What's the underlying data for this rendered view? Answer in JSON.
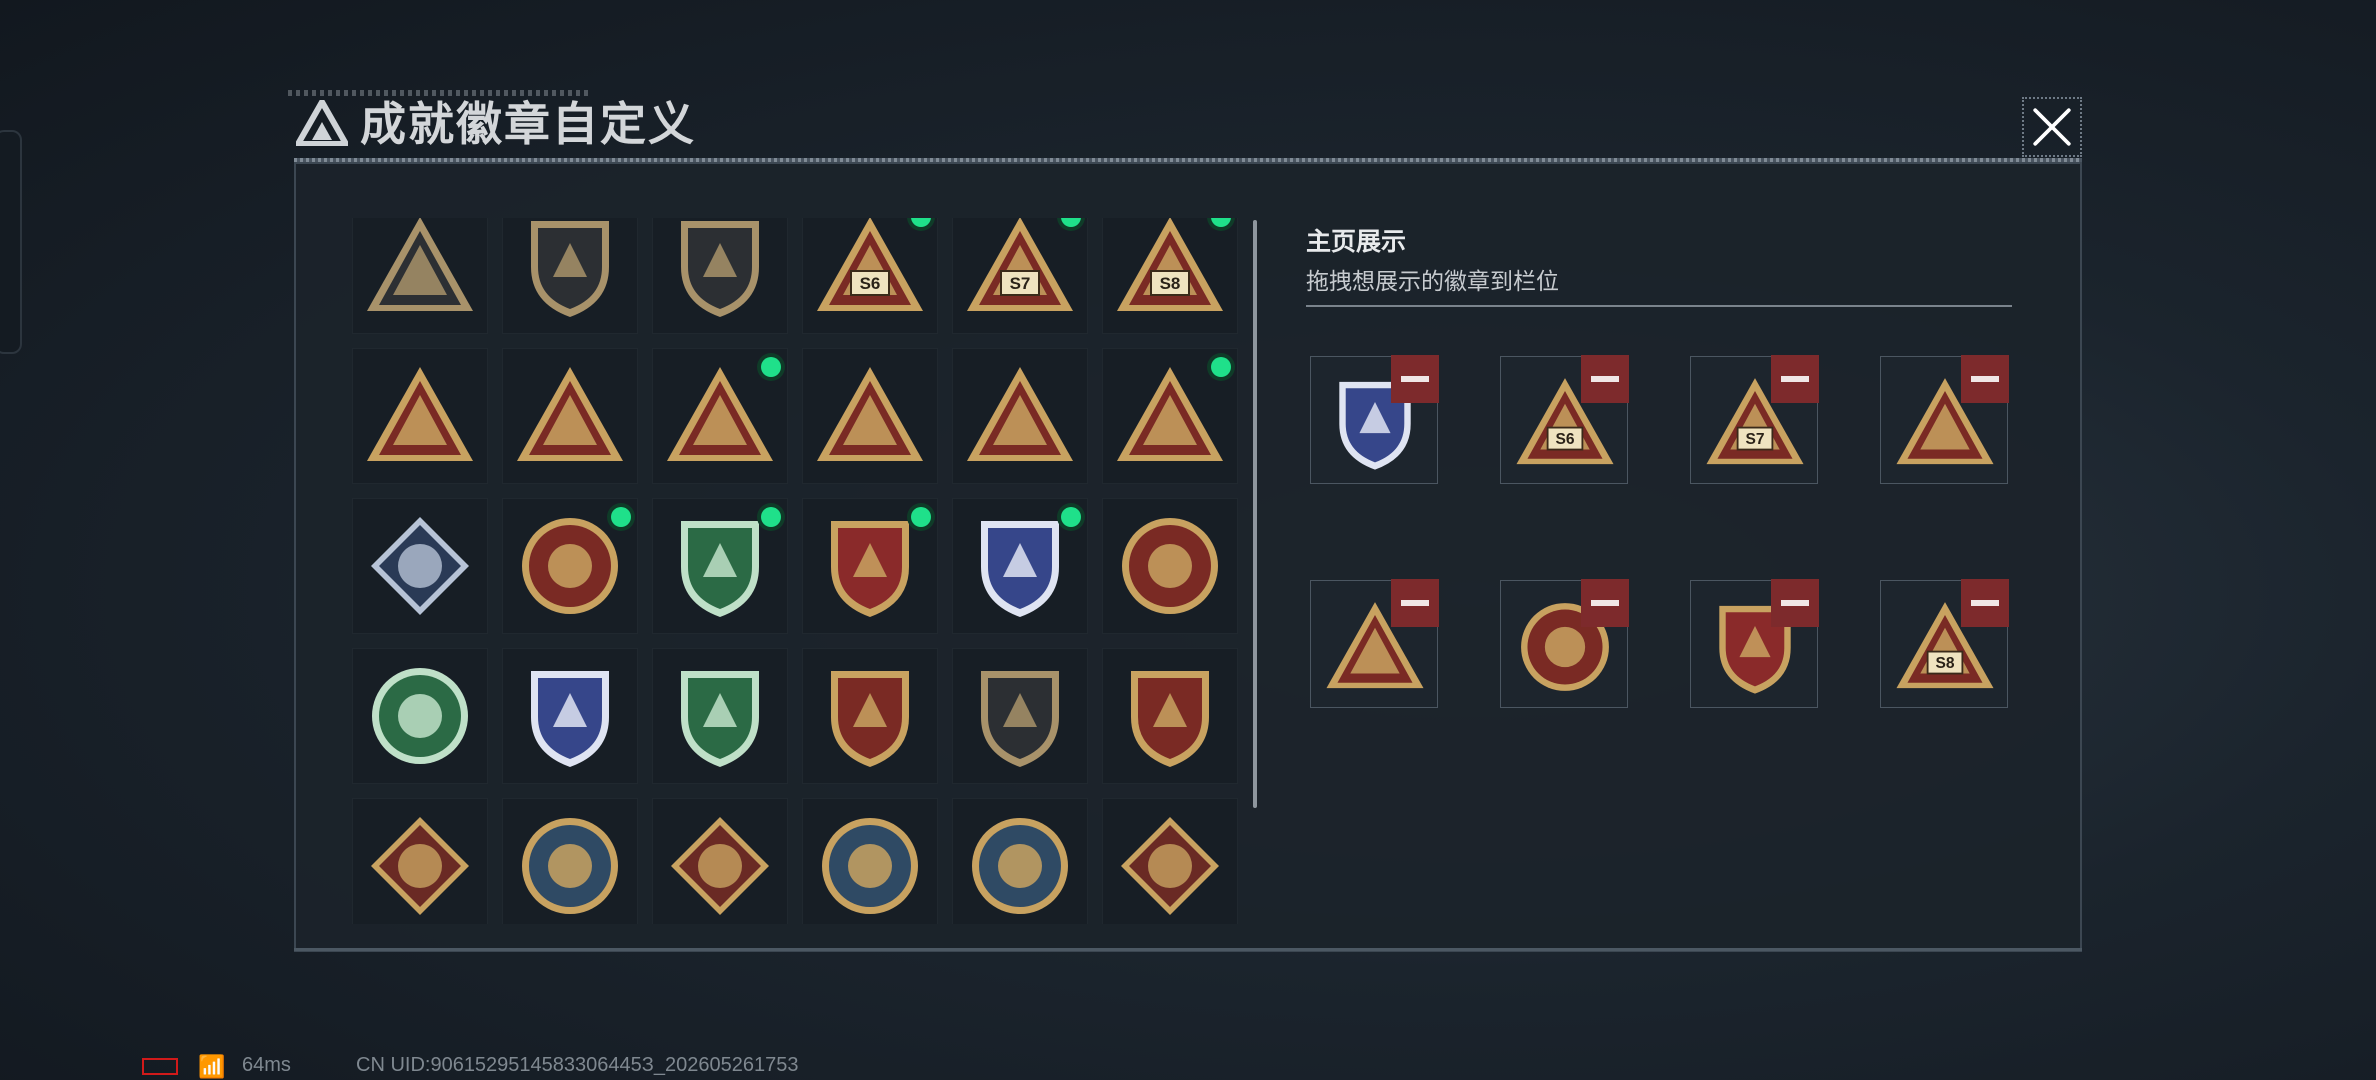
{
  "window": {
    "title": "成就徽章自定义",
    "close_icon": "close-icon"
  },
  "colors": {
    "gold": "#c8a260",
    "red": "#7a2a24",
    "navy": "#3a4a8c",
    "green": "#2e7a4a",
    "new_dot": "#1fe08a",
    "remove": "#7d2a2c"
  },
  "badge_grid": {
    "rows": [
      [
        {
          "icon": "delta-triangle-shield-badge",
          "new": false
        },
        {
          "icon": "helicopter-shield-badge",
          "new": false
        },
        {
          "icon": "dagger-shield-badge",
          "new": false
        },
        {
          "icon": "season-badge",
          "label": "S6",
          "new": true
        },
        {
          "icon": "season-badge",
          "label": "S7",
          "new": true
        },
        {
          "icon": "season-badge",
          "label": "S8",
          "new": true
        }
      ],
      [
        {
          "icon": "helmet-triangle-badge",
          "new": false
        },
        {
          "icon": "number-one-triangle-badge",
          "new": false
        },
        {
          "icon": "bottle-triangle-badge",
          "new": true
        },
        {
          "icon": "skull-triangle-badge",
          "new": false
        },
        {
          "icon": "squad-triangle-badge",
          "new": false
        },
        {
          "icon": "rocket-triangle-badge",
          "new": true
        }
      ],
      [
        {
          "icon": "rocket-launcher-diamond-badge",
          "new": false
        },
        {
          "icon": "star-round-badge",
          "new": true
        },
        {
          "icon": "green-shield-badge",
          "new": true
        },
        {
          "icon": "red-star-shield-badge",
          "new": true
        },
        {
          "icon": "blue-gem-shield-badge",
          "new": true
        },
        {
          "icon": "round-gold-medal-badge",
          "new": false
        }
      ],
      [
        {
          "icon": "green-crest-badge",
          "new": false
        },
        {
          "icon": "blue-crosshair-shield-badge",
          "new": false
        },
        {
          "icon": "green-crosshair-shield-badge",
          "new": false
        },
        {
          "icon": "gold-rifle-shield-badge",
          "new": false
        },
        {
          "icon": "dark-rifle-shield-badge",
          "new": false
        },
        {
          "icon": "gold-crosshair-shield-badge",
          "new": false
        }
      ],
      [
        {
          "icon": "wolf-diamond-badge",
          "new": false
        },
        {
          "icon": "eagle-round-badge",
          "new": false
        },
        {
          "icon": "dragon-diamond-badge",
          "new": false
        },
        {
          "icon": "wildcat-round-badge",
          "new": false
        },
        {
          "icon": "wolf-round-badge",
          "new": false
        },
        {
          "icon": "horse-diamond-badge",
          "new": false
        }
      ]
    ]
  },
  "showcase": {
    "title": "主页展示",
    "subtitle": "拖拽想展示的徽章到栏位",
    "remove_icon": "minus-icon",
    "slots": [
      {
        "icon": "blue-gem-shield-badge"
      },
      {
        "icon": "season-badge",
        "label": "S6"
      },
      {
        "icon": "season-badge",
        "label": "S7"
      },
      {
        "icon": "rocket-triangle-badge"
      },
      {
        "icon": "bottle-triangle-badge"
      },
      {
        "icon": "star-round-badge"
      },
      {
        "icon": "red-star-shield-badge"
      },
      {
        "icon": "season-badge",
        "label": "S8"
      }
    ]
  },
  "status_bar": {
    "ping": "64ms",
    "uid": "CN UID:9061529514583306445З_202605261753",
    "battery_icon": "battery-low-icon",
    "wifi_icon": "wifi-icon"
  }
}
